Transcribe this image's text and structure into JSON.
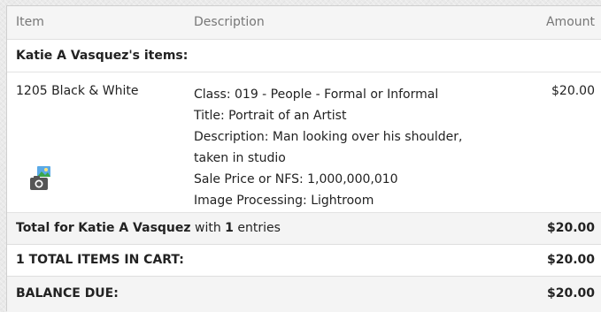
{
  "columns": {
    "item": "Item",
    "description": "Description",
    "amount": "Amount"
  },
  "owner_heading": "Katie A Vasquez's items:",
  "item": {
    "name": "1205 Black & White",
    "icon": "photo-camera-icon",
    "description_lines": [
      "Class: 019 - People - Formal or Informal",
      "Title: Portrait of an Artist",
      "Description: Man looking over his shoulder, taken in studio",
      "Sale Price or NFS: 1,000,000,010",
      "Image Processing: Lightroom"
    ],
    "amount": "$20.00"
  },
  "subtotal": {
    "prefix": "Total for",
    "name": "Katie A Vasquez",
    "with_text": "with",
    "count": "1",
    "suffix": "entries",
    "amount": "$20.00"
  },
  "cart_total": {
    "label": "1 TOTAL ITEMS IN CART:",
    "amount": "$20.00"
  },
  "balance": {
    "label": "BALANCE DUE:",
    "amount": "$20.00"
  },
  "colors": {
    "header_bg": "#f5f5f5",
    "total_bg": "#f4f4f4",
    "muted_text": "#777777",
    "icon_sky": "#5aa9e6",
    "icon_green": "#3aa64a"
  }
}
